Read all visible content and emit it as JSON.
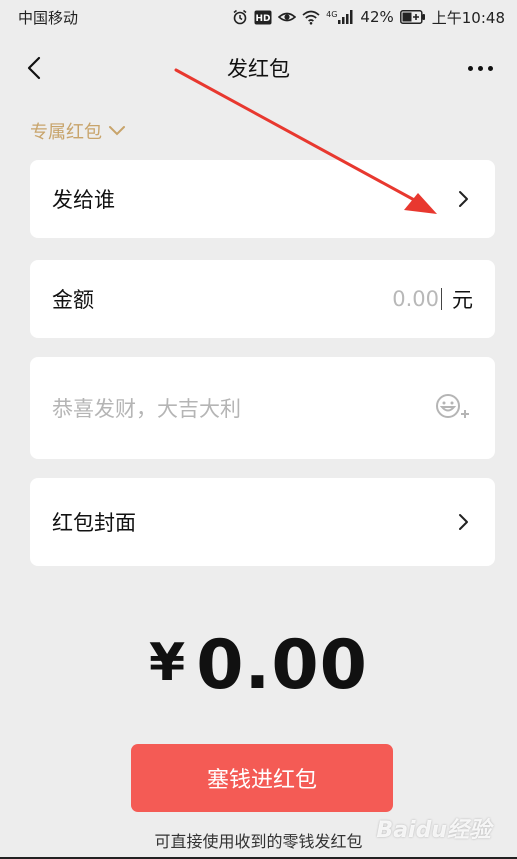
{
  "status_bar": {
    "carrier": "中国移动",
    "battery": "42%",
    "time": "上午10:48",
    "network": "4G"
  },
  "nav": {
    "title": "发红包"
  },
  "category": {
    "label": "专属红包"
  },
  "recipient_row": {
    "label": "发给谁"
  },
  "amount_row": {
    "label": "金额",
    "placeholder": "0.00",
    "unit": "元"
  },
  "blessing_row": {
    "placeholder": "恭喜发财，大吉大利"
  },
  "cover_row": {
    "label": "红包封面"
  },
  "total": {
    "currency": "¥",
    "amount": "0.00"
  },
  "send_button": {
    "label": "塞钱进红包"
  },
  "hint": {
    "text": "可直接使用收到的零钱发红包"
  },
  "watermark": {
    "text": "Baidu经验"
  },
  "colors": {
    "background": "#ededed",
    "button": "#f45b55",
    "accent_gold": "#c8a46b",
    "annotation_arrow": "#e8382f"
  }
}
